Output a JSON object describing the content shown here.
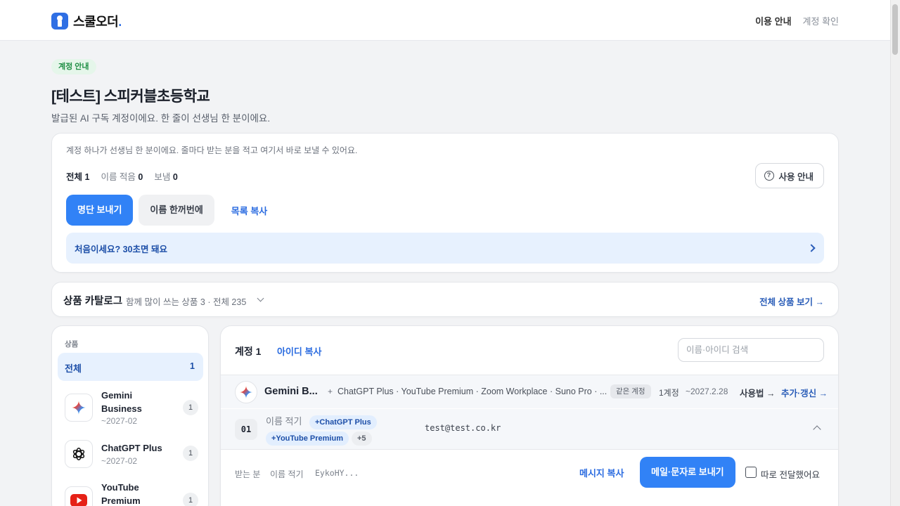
{
  "brand": {
    "name": "스쿨오더",
    "dot": "."
  },
  "nav": {
    "guide": "이용 안내",
    "check": "계정 확인"
  },
  "header": {
    "badge": "계정 안내",
    "title": "[테스트] 스피커블초등학교",
    "subtitle": "발급된 AI 구독 계정이에요. 한 줄이 선생님 한 분이에요."
  },
  "summary": {
    "description": "계정 하나가 선생님 한 분이에요. 줄마다 받는 분을 적고 여기서 바로 보낼 수 있어요.",
    "stats": {
      "total_label": "전체",
      "total": "1",
      "named_label": "이름 적음",
      "named": "0",
      "sent_label": "보냄",
      "sent": "0"
    },
    "help_label": "사용 안내",
    "buttons": {
      "send_list": "명단 보내기",
      "bulk_names": "이름 한꺼번에",
      "copy_list": "목록 복사"
    },
    "banner": "처음이세요? 30초면 돼요"
  },
  "catalog": {
    "title": "상품 카탈로그",
    "subtitle": "함께 많이 쓰는 상품 3 · 전체 235",
    "view_all": "전체 상품 보기 →"
  },
  "sidebar": {
    "label": "상품",
    "all": {
      "label": "전체",
      "count": "1"
    },
    "items": [
      {
        "name": "Gemini Business",
        "date": "~2027-02",
        "count": "1",
        "icon": "gemini-icon"
      },
      {
        "name": "ChatGPT Plus",
        "date": "~2027-02",
        "count": "1",
        "icon": "chatgpt-icon"
      },
      {
        "name": "YouTube Premium",
        "date": "",
        "count": "1",
        "icon": "youtube-icon"
      }
    ]
  },
  "main": {
    "account_title": "계정 1",
    "copy_ids": "아이디 복사",
    "search_placeholder": "이름·아이디 검색",
    "product": {
      "name": "Gemini B...",
      "plus": "+",
      "extras": "ChatGPT Plus · YouTube Premium · Zoom Workplace · Suno Pro · ...",
      "badge": "같은 계정",
      "count": "1계정",
      "expiry": "~2027.2.28",
      "usage": "사용법 →",
      "renew": "추가·갱신 →"
    },
    "account": {
      "number": "01",
      "name_placeholder": "이름 적기",
      "tags": [
        "+ChatGPT Plus",
        "+YouTube Premium"
      ],
      "more": "+5",
      "id": "test@test.co.kr"
    },
    "send": {
      "recipient_label": "받는 분",
      "name_placeholder": "이름 적기",
      "id_snippet": "EykoHY...",
      "copy_message": "메시지 복사",
      "send_button": "메일·문자로 보내기",
      "manual_label": "따로 전달했어요"
    }
  },
  "colors": {
    "accent": "#3182f6",
    "link": "#2a6be0",
    "badge_green": "#1f8f45"
  }
}
